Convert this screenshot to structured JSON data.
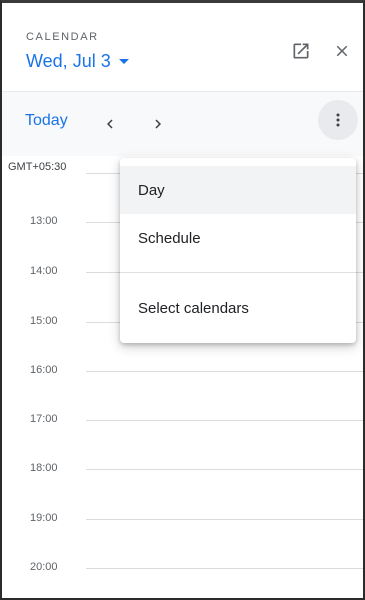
{
  "header": {
    "app_label": "CALENDAR",
    "date_label": "Wed, Jul 3",
    "icons": {
      "open": "open-in-new-icon",
      "close": "close-icon"
    }
  },
  "nav": {
    "today_label": "Today",
    "icons": {
      "prev": "chevron-left-icon",
      "next": "chevron-right-icon",
      "more": "more-vert-icon"
    }
  },
  "timeline": {
    "timezone": "GMT+05:30",
    "hours": [
      "13:00",
      "14:00",
      "15:00",
      "16:00",
      "17:00",
      "18:00",
      "19:00",
      "20:00"
    ]
  },
  "menu": {
    "items": [
      {
        "label": "Day",
        "selected": true
      },
      {
        "label": "Schedule",
        "selected": false
      },
      {
        "label": "Select calendars",
        "selected": false
      }
    ]
  },
  "colors": {
    "accent": "#1a73e8",
    "text_primary": "#202124",
    "text_secondary": "#5f6368",
    "grid_line": "#dadce0",
    "nav_bg": "#f8f9fa",
    "menu_hover": "#f1f3f4"
  }
}
